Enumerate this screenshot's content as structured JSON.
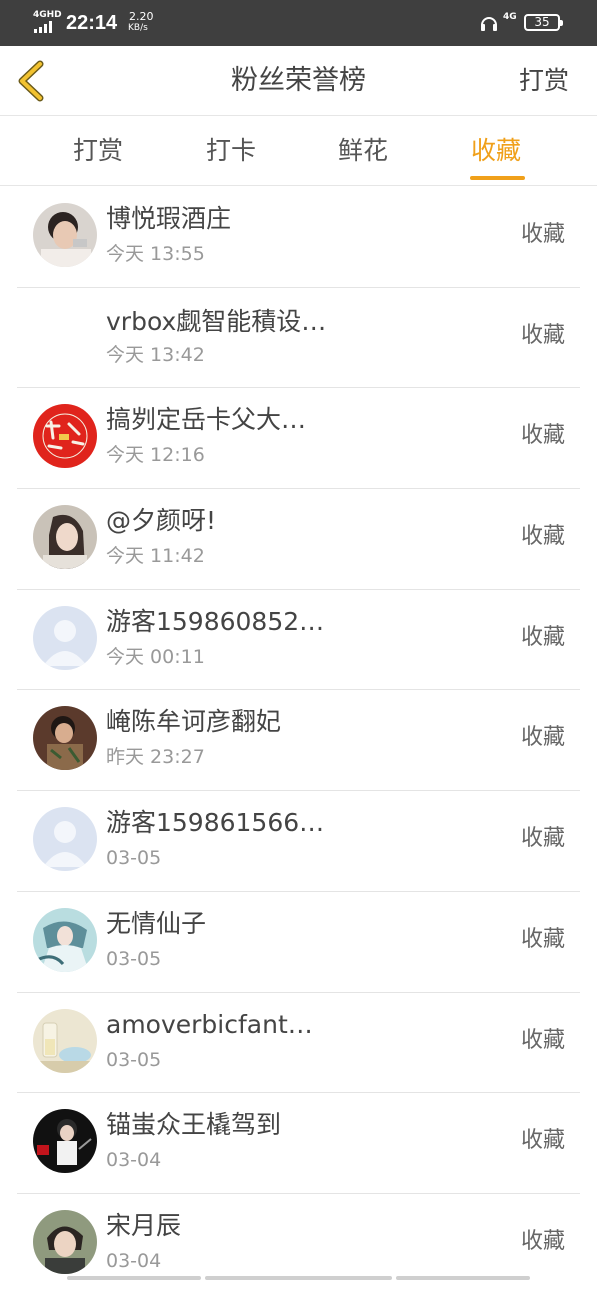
{
  "status_bar": {
    "network": "4GHD",
    "time": "22:14",
    "speed_value": "2.20",
    "speed_unit": "KB/s",
    "signal_label": "4G",
    "battery": "35"
  },
  "nav": {
    "title": "粉丝荣誉榜",
    "action_label": "打赏"
  },
  "tabs": [
    {
      "label": "打赏",
      "active": false
    },
    {
      "label": "打卡",
      "active": false
    },
    {
      "label": "鲜花",
      "active": false
    },
    {
      "label": "收藏",
      "active": true
    }
  ],
  "colors": {
    "accent": "#f0a01a",
    "text": "#444444",
    "muted": "#999999",
    "status_bar": "#3f3f3f"
  },
  "fans": [
    {
      "name": "博悦瑕酒庄",
      "time": "今天 13:55",
      "action": "收藏",
      "avatar": "photo-avatar"
    },
    {
      "name": "vrbox觑智能積设…",
      "time": "今天 13:42",
      "action": "收藏",
      "avatar": "none"
    },
    {
      "name": "搞刿定岳卡父大…",
      "time": "今天 12:16",
      "action": "收藏",
      "avatar": "red-seal-avatar"
    },
    {
      "name": "@夕颜呀!",
      "time": "今天 11:42",
      "action": "收藏",
      "avatar": "photo-avatar"
    },
    {
      "name": "游客159860852…",
      "time": "今天 00:11",
      "action": "收藏",
      "avatar": "default-user-avatar"
    },
    {
      "name": "崦陈牟诃彦翻妃",
      "time": "昨天 23:27",
      "action": "收藏",
      "avatar": "photo-avatar"
    },
    {
      "name": "游客159861566…",
      "time": "03-05",
      "action": "收藏",
      "avatar": "default-user-avatar"
    },
    {
      "name": "无情仙子",
      "time": "03-05",
      "action": "收藏",
      "avatar": "photo-avatar"
    },
    {
      "name": "amoverbicfant…",
      "time": "03-05",
      "action": "收藏",
      "avatar": "photo-avatar"
    },
    {
      "name": "锚蚩众王橇驾到",
      "time": "03-04",
      "action": "收藏",
      "avatar": "photo-avatar"
    },
    {
      "name": "宋月辰",
      "time": "03-04",
      "action": "收藏",
      "avatar": "photo-avatar"
    }
  ]
}
